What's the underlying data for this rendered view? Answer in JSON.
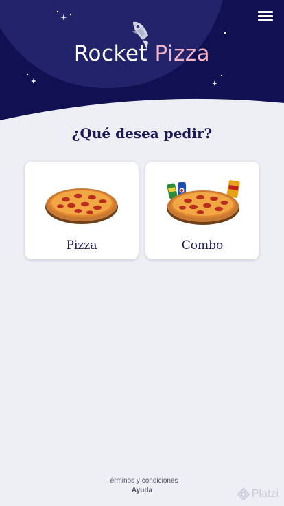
{
  "header": {
    "menu_icon": "hamburger-menu-icon",
    "logo": {
      "word1": "Rocket",
      "word2": "Pizza",
      "icon": "rocket-icon"
    },
    "colors": {
      "navy": "#101053",
      "navy_light": "#24246a",
      "pink": "#f4b4c7",
      "white": "#ffffff"
    }
  },
  "main": {
    "question": "¿Qué desea pedir?",
    "options": [
      {
        "label": "Pizza",
        "icon": "pizza-image"
      },
      {
        "label": "Combo",
        "icon": "combo-image"
      }
    ]
  },
  "footer": {
    "terms": "Términos y condiciones",
    "help": "Ayuda"
  },
  "watermark": {
    "text": "Platzi",
    "icon": "platzi-logo-icon"
  },
  "colors": {
    "background": "#eeeef5",
    "text": "#1b1b57",
    "card": "#ffffff"
  }
}
